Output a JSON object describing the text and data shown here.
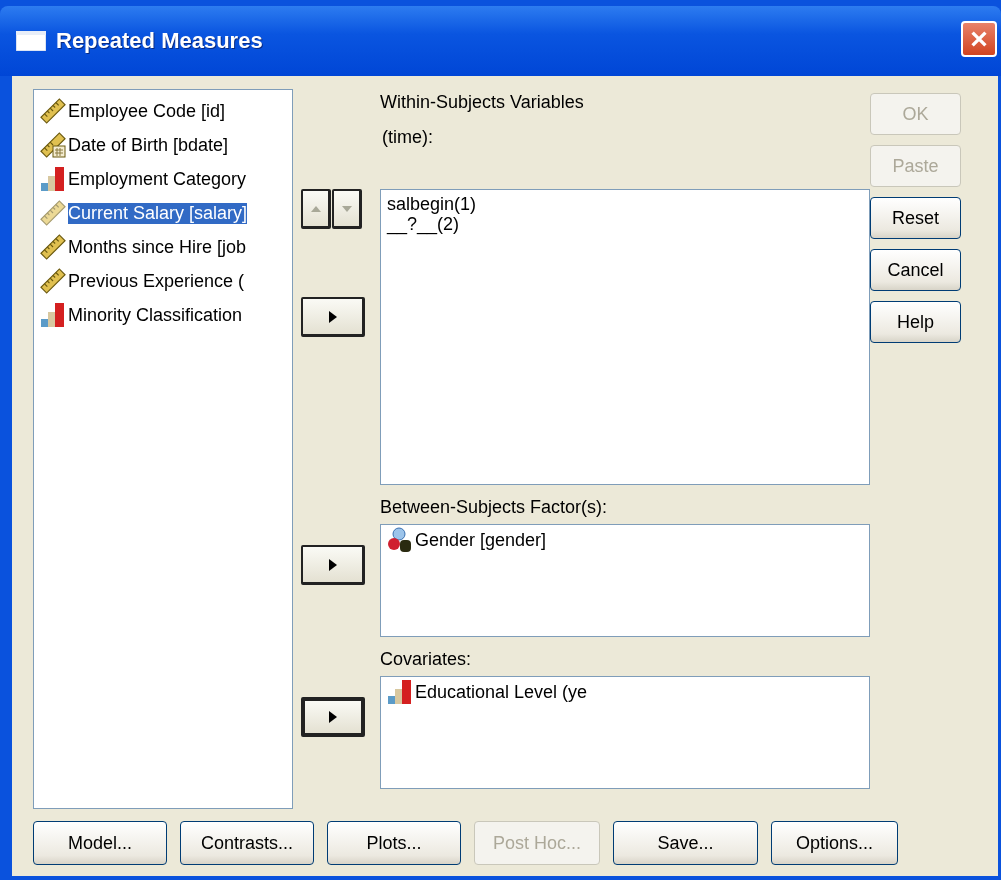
{
  "window": {
    "title": "Repeated Measures"
  },
  "variables": [
    {
      "label": "Employee Code [id]",
      "kind": "scale",
      "selected": false
    },
    {
      "label": "Date of Birth [bdate]",
      "kind": "date",
      "selected": false
    },
    {
      "label": "Employment Category",
      "kind": "ordinal",
      "selected": false
    },
    {
      "label": "Current Salary [salary]",
      "kind": "scale",
      "selected": true
    },
    {
      "label": "Months since Hire [job",
      "kind": "scale",
      "selected": false
    },
    {
      "label": "Previous Experience (",
      "kind": "scale",
      "selected": false
    },
    {
      "label": "Minority Classification",
      "kind": "ordinal",
      "selected": false
    }
  ],
  "within_subjects": {
    "label": "Within-Subjects Variables",
    "sublabel": "(time):",
    "items": [
      "salbegin(1)",
      "__?__(2)"
    ],
    "reorder_buttons": [
      {
        "kind": "up",
        "disabled": true
      },
      {
        "kind": "down",
        "disabled": true
      }
    ],
    "move_button": {
      "focused": false
    }
  },
  "between_subjects": {
    "label": "Between-Subjects Factor(s):",
    "items": [
      {
        "label": "Gender [gender]",
        "kind": "string"
      }
    ],
    "move_button": {
      "focused": false
    }
  },
  "covariates": {
    "label": "Covariates:",
    "items": [
      {
        "label": "Educational Level (ye",
        "kind": "ordinal"
      }
    ],
    "move_button": {
      "focused": true
    }
  },
  "side_buttons": [
    {
      "label": "OK",
      "disabled": true
    },
    {
      "label": "Paste",
      "disabled": true
    },
    {
      "label": "Reset",
      "disabled": false
    },
    {
      "label": "Cancel",
      "disabled": false
    },
    {
      "label": "Help",
      "disabled": false
    }
  ],
  "bottom_buttons": [
    {
      "label": "Model...",
      "disabled": false
    },
    {
      "label": "Contrasts...",
      "disabled": false
    },
    {
      "label": "Plots...",
      "disabled": false
    },
    {
      "label": "Post Hoc...",
      "disabled": true
    },
    {
      "label": "Save...",
      "disabled": false
    },
    {
      "label": "Options...",
      "disabled": false
    }
  ]
}
